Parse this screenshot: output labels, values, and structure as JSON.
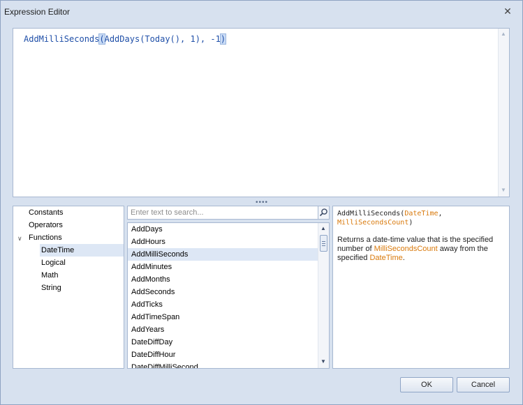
{
  "window": {
    "title": "Expression Editor"
  },
  "editor": {
    "fn1": "AddMilliSeconds",
    "fn2": "AddDays",
    "fn3": "Today",
    "arg1": "1",
    "arg2": "-1"
  },
  "tree": {
    "items": [
      "Constants",
      "Operators",
      "Functions"
    ],
    "children": [
      "DateTime",
      "Logical",
      "Math",
      "String"
    ],
    "selected": "DateTime"
  },
  "search": {
    "placeholder": "Enter text to search..."
  },
  "functions": {
    "items": [
      "AddDays",
      "AddHours",
      "AddMilliSeconds",
      "AddMinutes",
      "AddMonths",
      "AddSeconds",
      "AddTicks",
      "AddTimeSpan",
      "AddYears",
      "DateDiffDay",
      "DateDiffHour",
      "DateDiffMilliSecond"
    ],
    "selected": "AddMilliSeconds"
  },
  "description": {
    "fn": "AddMilliSeconds(",
    "p1": "DateTime",
    "comma": ",",
    "p2": "MilliSecondsCount",
    "close": ")",
    "text1": "Returns a date-time value that is the specified number of ",
    "text2": "MilliSecondsCount",
    "text3": " away from the specified ",
    "text4": "DateTime",
    "text5": "."
  },
  "buttons": {
    "ok": "OK",
    "cancel": "Cancel"
  },
  "colors": {
    "accent": "#1f4fa8",
    "param": "#d9790b",
    "selection": "#dde7f5"
  }
}
